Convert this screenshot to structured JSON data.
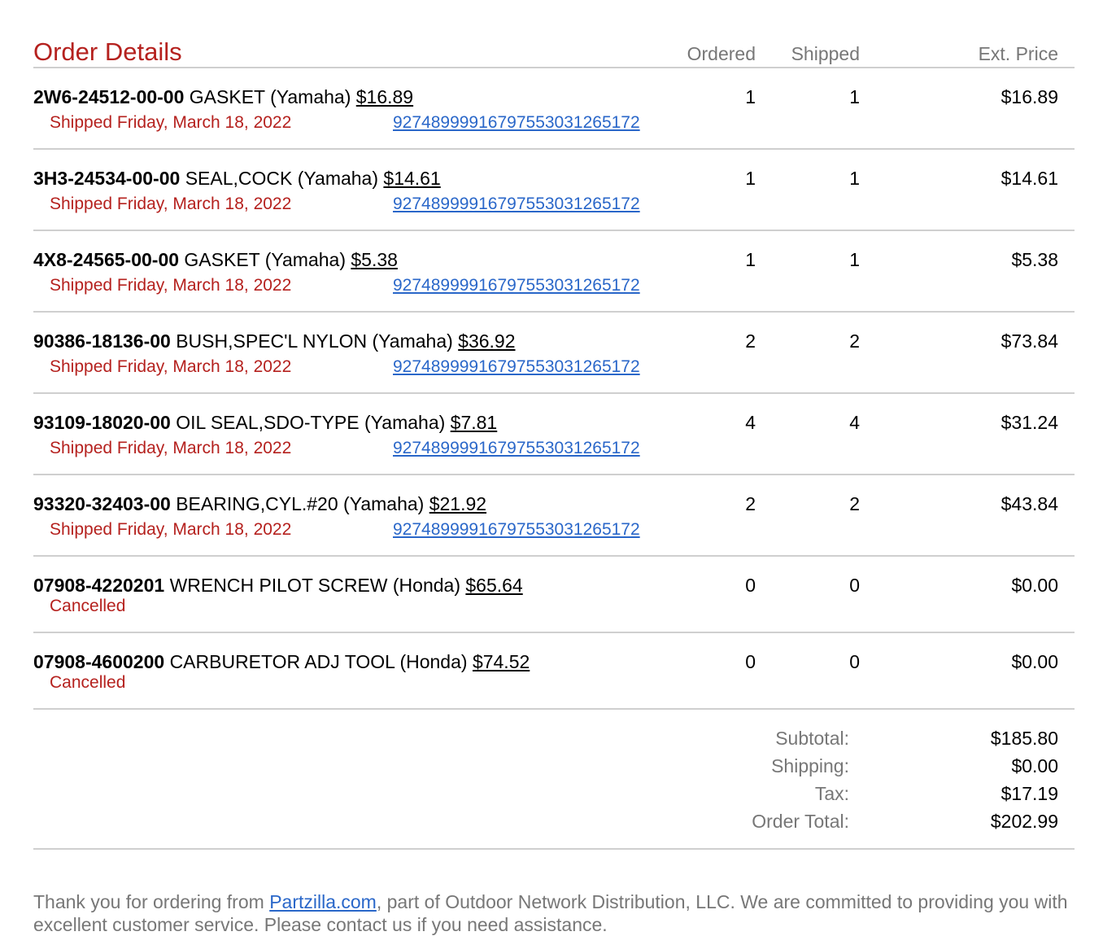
{
  "header": {
    "title": "Order Details",
    "col_ordered": "Ordered",
    "col_shipped": "Shipped",
    "col_ext": "Ext. Price"
  },
  "items": [
    {
      "part": "2W6-24512-00-00",
      "desc": "GASKET (Yamaha)",
      "price": "$16.89",
      "status": "Shipped Friday, March 18, 2022",
      "tracking": "9274899991679755303126517​2",
      "ordered": "1",
      "shipped": "1",
      "ext": "$16.89"
    },
    {
      "part": "3H3-24534-00-00",
      "desc": "SEAL,COCK (Yamaha)",
      "price": "$14.61",
      "status": "Shipped Friday, March 18, 2022",
      "tracking": "92748999916797553031265172",
      "ordered": "1",
      "shipped": "1",
      "ext": "$14.61"
    },
    {
      "part": "4X8-24565-00-00",
      "desc": "GASKET (Yamaha)",
      "price": "$5.38",
      "status": "Shipped Friday, March 18, 2022",
      "tracking": "92748999916797553031265172",
      "ordered": "1",
      "shipped": "1",
      "ext": "$5.38"
    },
    {
      "part": "90386-18136-00",
      "desc": "BUSH,SPEC'L NYLON (Yamaha)",
      "price": "$36.92",
      "status": "Shipped Friday, March 18, 2022",
      "tracking": "92748999916797553031265172",
      "ordered": "2",
      "shipped": "2",
      "ext": "$73.84"
    },
    {
      "part": "93109-18020-00",
      "desc": "OIL SEAL,SDO-TYPE (Yamaha)",
      "price": "$7.81",
      "status": "Shipped Friday, March 18, 2022",
      "tracking": "92748999916797553031265172",
      "ordered": "4",
      "shipped": "4",
      "ext": "$31.24"
    },
    {
      "part": "93320-32403-00",
      "desc": "BEARING,CYL.#20 (Yamaha)",
      "price": "$21.92",
      "status": "Shipped Friday, March 18, 2022",
      "tracking": "92748999916797553031265172",
      "ordered": "2",
      "shipped": "2",
      "ext": "$43.84"
    },
    {
      "part": "07908-4220201",
      "desc": "WRENCH PILOT SCREW (Honda)",
      "price": "$65.64",
      "status": "Cancelled",
      "tracking": "",
      "ordered": "0",
      "shipped": "0",
      "ext": "$0.00"
    },
    {
      "part": "07908-4600200",
      "desc": "CARBURETOR ADJ TOOL (Honda)",
      "price": "$74.52",
      "status": "Cancelled",
      "tracking": "",
      "ordered": "0",
      "shipped": "0",
      "ext": "$0.00"
    }
  ],
  "totals": {
    "subtotal_label": "Subtotal:",
    "subtotal": "$185.80",
    "shipping_label": "Shipping:",
    "shipping": "$0.00",
    "tax_label": "Tax:",
    "tax": "$17.19",
    "total_label": "Order Total:",
    "total": "$202.99"
  },
  "footer": {
    "text_before": "Thank you for ordering from ",
    "link": "Partzilla.com",
    "text_after": ", part of Outdoor Network Distribution, LLC. We are committed to providing you with excellent customer service. Please contact us if you need assistance."
  }
}
